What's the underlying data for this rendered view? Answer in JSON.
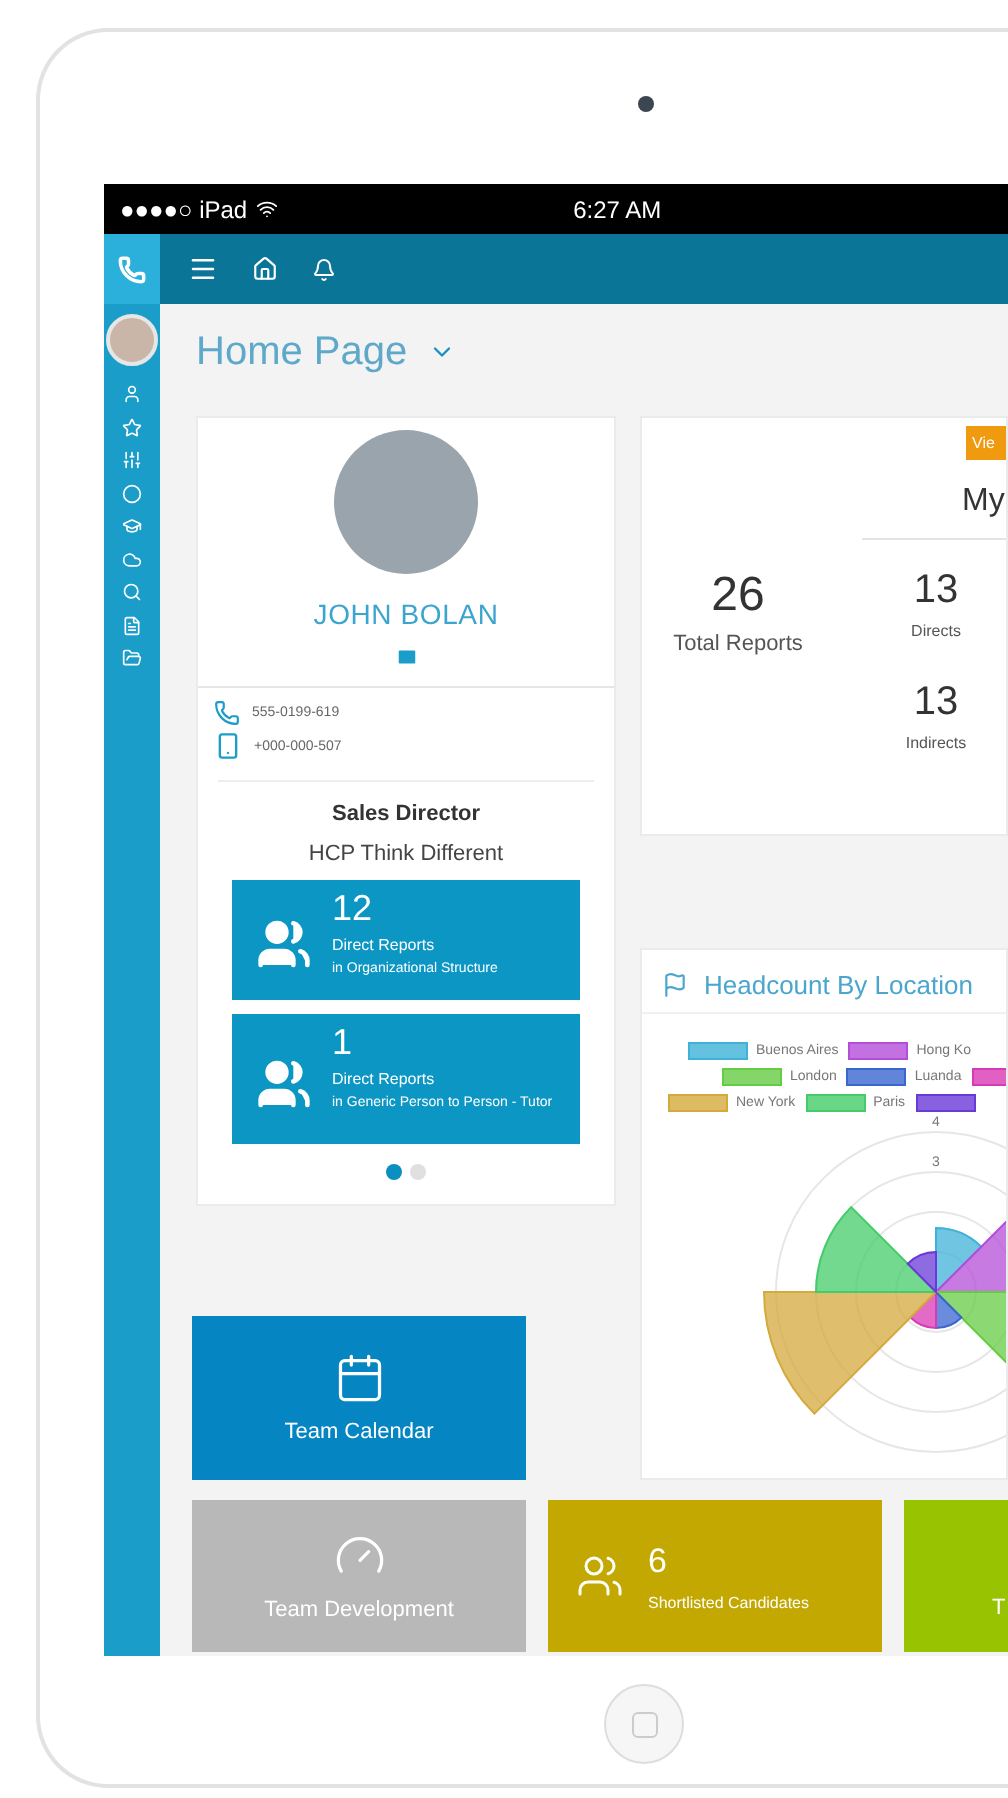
{
  "status_bar": {
    "carrier": "●●●●○ iPad",
    "time": "6:27 AM"
  },
  "page_title": "Home Page",
  "profile": {
    "name": "JOHN BOLAN",
    "phones": [
      {
        "kind": "phone",
        "number": "555-0199-619"
      },
      {
        "kind": "mobile",
        "number": "+000-000-507"
      }
    ],
    "position": "Sales Director",
    "company": "HCP Think Different",
    "reports": [
      {
        "count": "12",
        "label": "Direct Reports",
        "detail": "in Organizational Structure"
      },
      {
        "count": "1",
        "label": "Direct Reports",
        "detail": "in Generic Person to Person - Tutor"
      }
    ],
    "pages": [
      {
        "selected": true
      },
      {
        "selected": false
      }
    ]
  },
  "team_summary": {
    "button": "Vie",
    "title": "My",
    "total": {
      "value": "26",
      "label": "Total Reports"
    },
    "stats": [
      {
        "value": "13",
        "label": "Directs"
      },
      {
        "value": "13",
        "label": "Indirects"
      }
    ]
  },
  "headcount": {
    "title": "Headcount By Location",
    "legend": [
      [
        {
          "label": "Buenos Aires",
          "color": "#3fb2d8"
        },
        {
          "label": "Hong Ko",
          "color": "#b44ed8"
        }
      ],
      [
        {
          "label": "London",
          "color": "#66cc44"
        },
        {
          "label": "Luanda",
          "color": "#3a66d0"
        },
        {
          "color": "#d83ab4"
        }
      ],
      [
        {
          "label": "New York",
          "color": "#d4aa3c"
        },
        {
          "label": "Paris",
          "color": "#44cc6a"
        },
        {
          "color": "#6a3ad8"
        }
      ]
    ],
    "ticks": [
      "4",
      "3"
    ]
  },
  "tiles": [
    {
      "kind": "stacked",
      "label": "Team Calendar",
      "color": "#0585c2"
    },
    {
      "kind": "stacked",
      "label": "Team Development",
      "color": "#b8b8b8"
    },
    {
      "kind": "count",
      "count": "6",
      "label": "Shortlisted Candidates",
      "color": "#c2a800"
    },
    {
      "kind": "cut",
      "label": "T",
      "color": "#97c300"
    }
  ]
}
